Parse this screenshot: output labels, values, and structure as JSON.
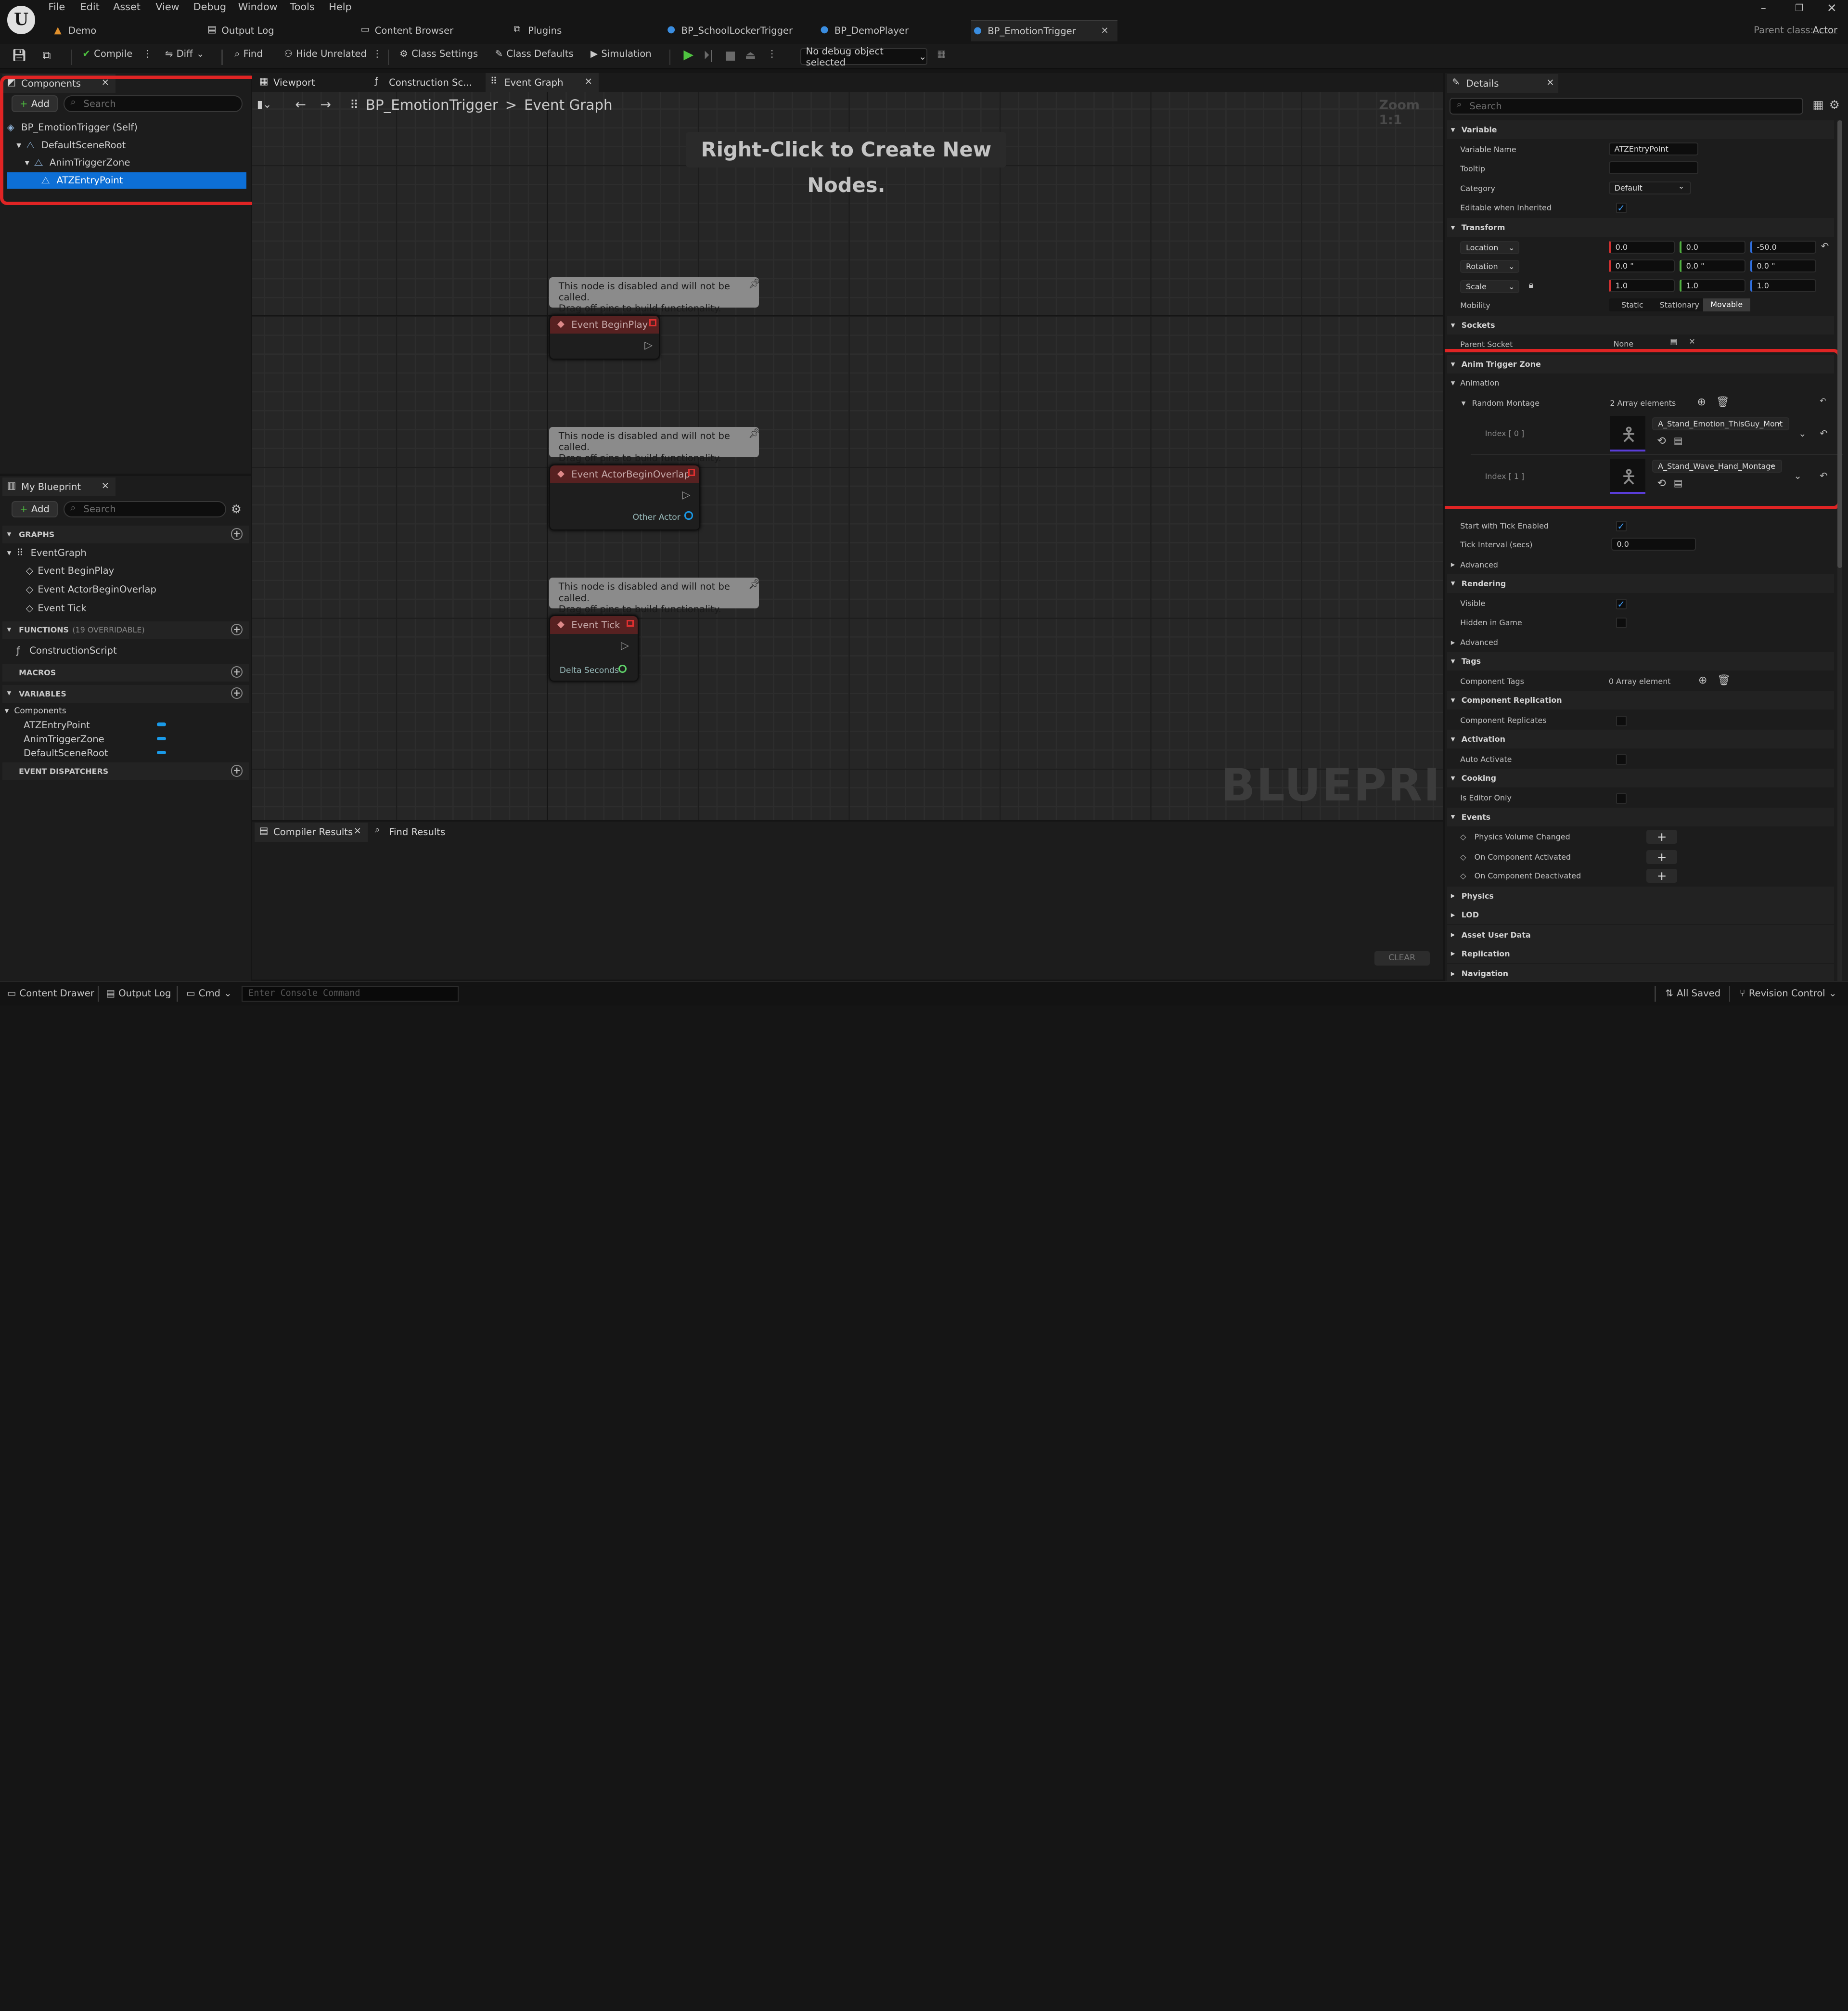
{
  "menu": [
    "File",
    "Edit",
    "Asset",
    "View",
    "Debug",
    "Window",
    "Tools",
    "Help"
  ],
  "doc_tabs": [
    "Demo",
    "Output Log",
    "Content Browser",
    "Plugins",
    "BP_SchoolLockerTrigger",
    "BP_DemoPlayer",
    "BP_EmotionTrigger"
  ],
  "parent_class_label": "Parent class:",
  "parent_class_value": "Actor",
  "toolbar": {
    "compile": "Compile",
    "diff": "Diff",
    "find": "Find",
    "hide_unrelated": "Hide Unrelated",
    "class_settings": "Class Settings",
    "class_defaults": "Class Defaults",
    "simulation": "Simulation",
    "debug_object": "No debug object selected"
  },
  "components": {
    "tab": "Components",
    "add": "Add",
    "search_placeholder": "Search",
    "items": [
      "BP_EmotionTrigger (Self)",
      "DefaultSceneRoot",
      "AnimTriggerZone",
      "ATZEntryPoint"
    ]
  },
  "my_blueprint": {
    "tab": "My Blueprint",
    "add": "Add",
    "search_placeholder": "Search",
    "graphs_hdr": "GRAPHS",
    "event_graph": "EventGraph",
    "events": [
      "Event BeginPlay",
      "Event ActorBeginOverlap",
      "Event Tick"
    ],
    "functions_hdr": "FUNCTIONS",
    "functions_note": "(19 OVERRIDABLE)",
    "construction_script": "ConstructionScript",
    "macros_hdr": "MACROS",
    "variables_hdr": "VARIABLES",
    "components_cat": "Components",
    "variables": [
      "ATZEntryPoint",
      "AnimTriggerZone",
      "DefaultSceneRoot"
    ],
    "dispatchers_hdr": "EVENT DISPATCHERS"
  },
  "graph": {
    "tabs": [
      "Viewport",
      "Construction Sc...",
      "Event Graph"
    ],
    "breadcrumb_bp": "BP_EmotionTrigger",
    "breadcrumb_sep": ">",
    "breadcrumb_graph": "Event Graph",
    "zoom": "Zoom 1:1",
    "hint": "Right-Click to Create New Nodes.",
    "watermark": "BLUEPRINT",
    "comment_line1": "This node is disabled and will not be called.",
    "comment_line2": "Drag off pins to build functionality.",
    "node_beginplay": "Event BeginPlay",
    "node_overlap": "Event ActorBeginOverlap",
    "pin_other_actor": "Other Actor",
    "node_tick": "Event Tick",
    "pin_delta": "Delta Seconds"
  },
  "bottom": {
    "compiler_results": "Compiler Results",
    "find_results": "Find Results",
    "clear": "CLEAR"
  },
  "details": {
    "tab": "Details",
    "search_placeholder": "Search",
    "variable_hdr": "Variable",
    "variable_name_label": "Variable Name",
    "variable_name": "ATZEntryPoint",
    "tooltip_label": "Tooltip",
    "category_label": "Category",
    "category": "Default",
    "editable_label": "Editable when Inherited",
    "transform_hdr": "Transform",
    "location": "Location",
    "rotation": "Rotation",
    "scale": "Scale",
    "loc": [
      "0.0",
      "0.0",
      "-50.0"
    ],
    "rot": [
      "0.0 °",
      "0.0 °",
      "0.0 °"
    ],
    "scl": [
      "1.0",
      "1.0",
      "1.0"
    ],
    "mobility_label": "Mobility",
    "mobility": [
      "Static",
      "Stationary",
      "Movable"
    ],
    "sockets_hdr": "Sockets",
    "parent_socket_label": "Parent Socket",
    "parent_socket": "None",
    "anim_zone_hdr": "Anim Trigger Zone",
    "animation_hdr": "Animation",
    "random_montage": "Random Montage",
    "array_count": "2 Array elements",
    "index0": "Index [ 0 ]",
    "index0_val": "A_Stand_Emotion_ThisGuy_Mont",
    "index1": "Index [ 1 ]",
    "index1_val": "A_Stand_Wave_Hand_Montage",
    "start_tick": "Start with Tick Enabled",
    "tick_interval": "Tick Interval (secs)",
    "tick_interval_val": "0.0",
    "advanced": "Advanced",
    "rendering_hdr": "Rendering",
    "visible": "Visible",
    "hidden_in_game": "Hidden in Game",
    "tags_hdr": "Tags",
    "component_tags": "Component Tags",
    "tags_count": "0 Array element",
    "replication_hdr": "Component Replication",
    "component_replicates": "Component Replicates",
    "activation_hdr": "Activation",
    "auto_activate": "Auto Activate",
    "cooking_hdr": "Cooking",
    "editor_only": "Is Editor Only",
    "events_hdr": "Events",
    "events": [
      "Physics Volume Changed",
      "On Component Activated",
      "On Component Deactivated"
    ],
    "collapsed": [
      "Physics",
      "LOD",
      "Asset User Data",
      "Replication",
      "Navigation"
    ]
  },
  "statusbar": {
    "content_drawer": "Content Drawer",
    "output_log": "Output Log",
    "cmd": "Cmd",
    "console_placeholder": "Enter Console Command",
    "all_saved": "All Saved",
    "revision_control": "Revision Control"
  },
  "colors": {
    "selected": "#0d6fd6",
    "highlight": "#e02424",
    "accent_blue": "#1a9ae8",
    "play_green": "#4fc340"
  }
}
